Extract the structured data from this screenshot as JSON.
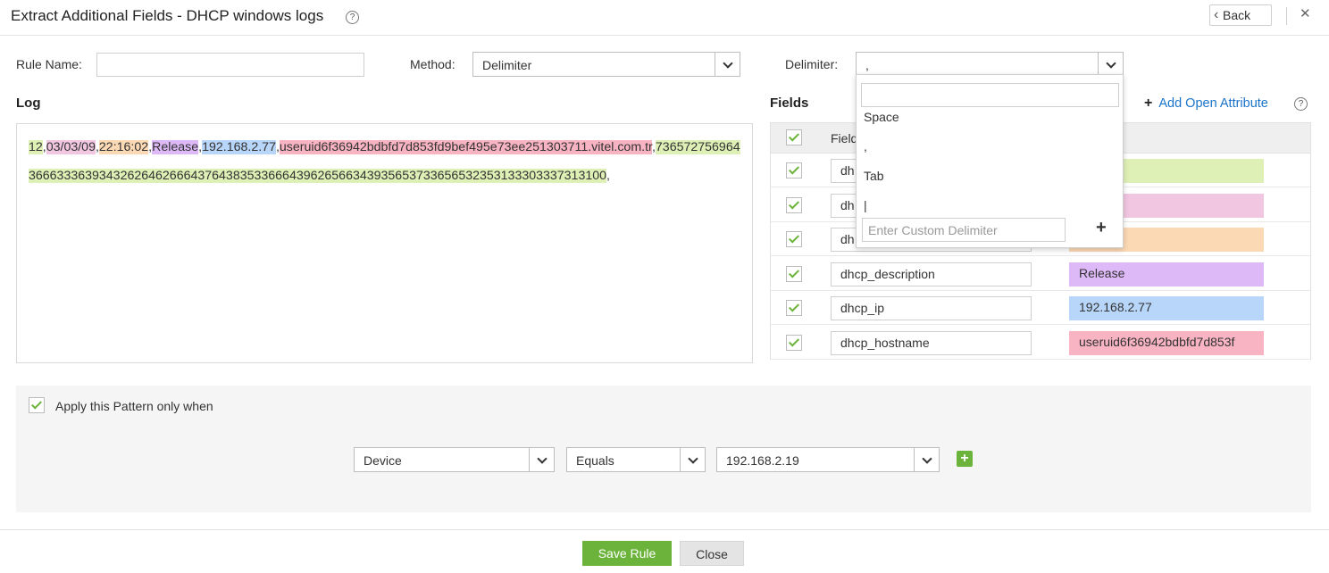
{
  "header": {
    "title": "Extract Additional Fields - DHCP windows logs",
    "help": "?",
    "back_label": "Back",
    "close": "✕"
  },
  "form": {
    "rule_name_label": "Rule Name:",
    "rule_name_value": "",
    "method_label": "Method:",
    "method_value": "Delimiter",
    "delimiter_label": "Delimiter:",
    "delimiter_value": ","
  },
  "log": {
    "title": "Log",
    "segments": [
      {
        "text": "12",
        "hl": "green"
      },
      {
        "text": ",",
        "hl": ""
      },
      {
        "text": "03/03/09",
        "hl": "pink"
      },
      {
        "text": ",",
        "hl": ""
      },
      {
        "text": "22:16:02",
        "hl": "orange"
      },
      {
        "text": ",",
        "hl": ""
      },
      {
        "text": "Release",
        "hl": "purple"
      },
      {
        "text": ",",
        "hl": ""
      },
      {
        "text": "192.168.2.77",
        "hl": "blue"
      },
      {
        "text": ",",
        "hl": ""
      },
      {
        "text": "useruid6f36942bdbfd7d853fd9bef495e73ee251303711.vitel.com.tr",
        "hl": "red"
      },
      {
        "text": ",",
        "hl": ""
      },
      {
        "text": "7365727569643666333639343262646266643764383533666439626566343935653733656532353133303337313100",
        "hl": "green"
      },
      {
        "text": ",",
        "hl": ""
      }
    ]
  },
  "fields": {
    "title": "Fields",
    "add_attr_label": "Add Open Attribute",
    "header_name_partial": "Field",
    "header_value_partial": "e",
    "rows": [
      {
        "name": "dh",
        "value": "",
        "color": "#dff0b6"
      },
      {
        "name": "dh",
        "value": "09",
        "color": "#f1c6e1"
      },
      {
        "name": "dh",
        "value": "02",
        "color": "#fcd9b5"
      },
      {
        "name": "dhcp_description",
        "value": "Release",
        "color": "#deb9f8"
      },
      {
        "name": "dhcp_ip",
        "value": "192.168.2.77",
        "color": "#b8d6f9"
      },
      {
        "name": "dhcp_hostname",
        "value": "useruid6f36942bdbfd7d853f",
        "color": "#f8b4c2"
      }
    ]
  },
  "delimiter_dropdown": {
    "search_value": "",
    "options": [
      "Space",
      ",",
      "Tab",
      "|"
    ],
    "custom_placeholder": "Enter Custom Delimiter"
  },
  "condition": {
    "apply_label": "Apply this Pattern only when",
    "field_value": "Device",
    "operator_value": "Equals",
    "value_value": "192.168.2.19"
  },
  "footer": {
    "save_label": "Save Rule",
    "close_label": "Close"
  }
}
